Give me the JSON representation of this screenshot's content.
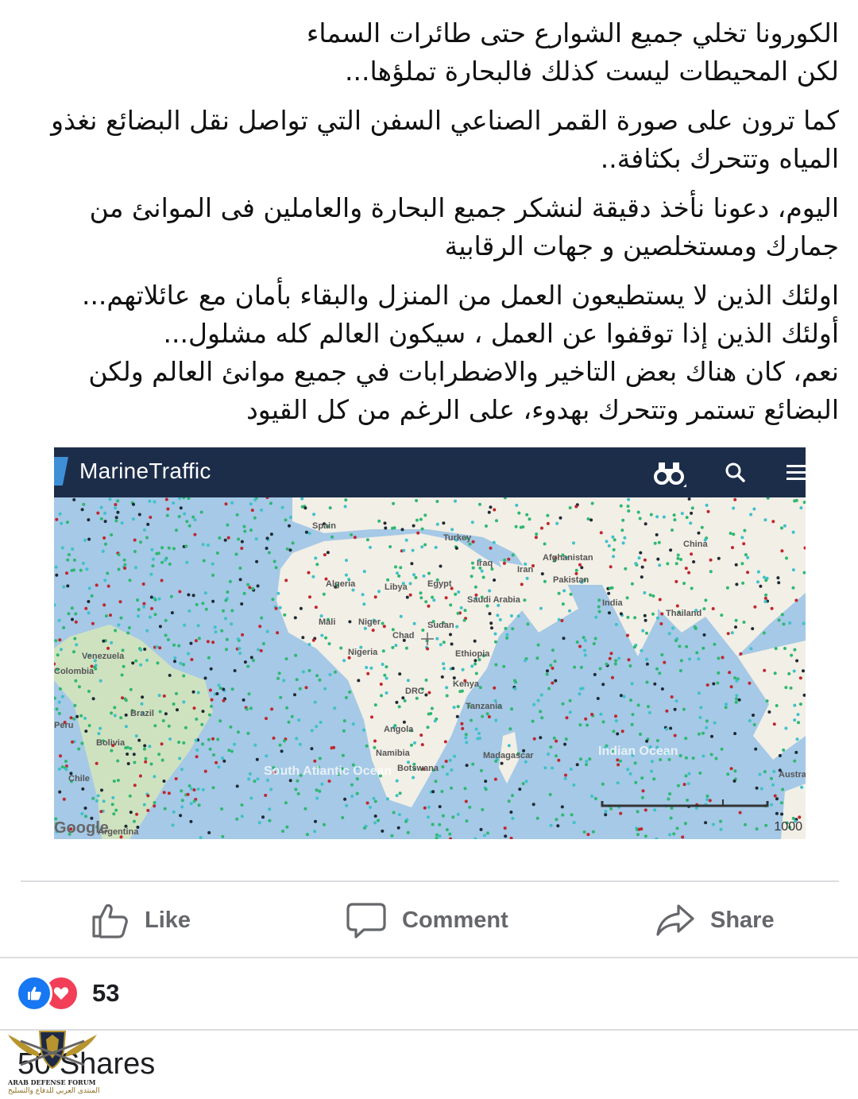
{
  "post": {
    "paragraphs": [
      [
        "الكورونا تخلي جميع الشوارع حتى طائرات السماء",
        "لكن المحيطات ليست كذلك فالبحارة تملؤها..."
      ],
      [
        "كما ترون على صورة القمر الصناعي السفن التي تواصل نقل البضائع نغذو",
        "المياه وتتحرك بكثافة.."
      ],
      [
        "اليوم، دعونا نأخذ دقيقة لنشكر جميع البحارة والعاملين فى الموانئ من",
        "جمارك ومستخلصين و جهات الرقابية"
      ],
      [
        "اولئك الذين لا يستطيعون العمل من المنزل والبقاء بأمان مع عائلاتهم...",
        "أولئك الذين إذا توقفوا عن العمل ، سيكون العالم كله مشلول...",
        "نعم، كان هناك بعض التاخير والاضطرابات في جميع موانئ العالم ولكن",
        "البضائع تستمر وتتحرك بهدوء، على الرغم من كل القيود"
      ]
    ]
  },
  "map": {
    "app_title": "MarineTraffic",
    "icons": [
      "binoculars-icon",
      "search-icon",
      "menu-icon"
    ],
    "labels": [
      {
        "text": "Spain"
      },
      {
        "text": "Turkey"
      },
      {
        "text": "Iraq"
      },
      {
        "text": "Iran"
      },
      {
        "text": "Afghanistan"
      },
      {
        "text": "Pakistan"
      },
      {
        "text": "China"
      },
      {
        "text": "Algeria"
      },
      {
        "text": "Libya"
      },
      {
        "text": "Egypt"
      },
      {
        "text": "Saudi Arabia"
      },
      {
        "text": "India"
      },
      {
        "text": "Thailand"
      },
      {
        "text": "Mali"
      },
      {
        "text": "Niger"
      },
      {
        "text": "Chad"
      },
      {
        "text": "Sudan"
      },
      {
        "text": "Nigeria"
      },
      {
        "text": "Ethiopia"
      },
      {
        "text": "Venezuela"
      },
      {
        "text": "Colombia"
      },
      {
        "text": "Kenya"
      },
      {
        "text": "DRC"
      },
      {
        "text": "Tanzania"
      },
      {
        "text": "Brazil"
      },
      {
        "text": "Peru"
      },
      {
        "text": "Angola"
      },
      {
        "text": "Bolivia"
      },
      {
        "text": "Namibia"
      },
      {
        "text": "Botswana"
      },
      {
        "text": "Madagascar"
      },
      {
        "text": "Chile"
      },
      {
        "text": "South Atlantic Ocean"
      },
      {
        "text": "Indian Ocean"
      },
      {
        "text": "Australia"
      },
      {
        "text": "Argentina"
      }
    ],
    "scale_label": "1000",
    "attribution": "Google",
    "colors": {
      "ocean": "#a5c9e6",
      "land": "#f2efe6",
      "bar": "#1c2d4a",
      "ship_green": "#2eb872",
      "ship_red": "#c0262d",
      "ship_cyan": "#3fc1c9",
      "ship_dark": "#1f2a34"
    }
  },
  "actions": {
    "like_label": "Like",
    "comment_label": "Comment",
    "share_label": "Share"
  },
  "reactions": {
    "count": "53"
  },
  "shares": {
    "text": "50 Shares"
  },
  "watermark": {
    "line1": "ARAB DEFENSE FORUM",
    "line2": "المنتدى العربي للدفاع والتسليح"
  }
}
